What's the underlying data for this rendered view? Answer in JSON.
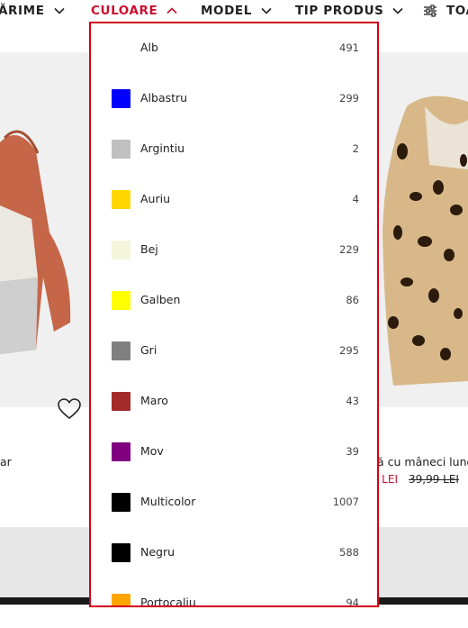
{
  "filters": [
    {
      "label": "ĂRIME",
      "active": false
    },
    {
      "label": "CULOARE",
      "active": true
    },
    {
      "label": "MODEL",
      "active": false
    },
    {
      "label": "TIP PRODUS",
      "active": false
    },
    {
      "label": "TOA",
      "active": false
    }
  ],
  "colors": {
    "accent": "#c8102e",
    "dropdown_border": "#d0021b"
  },
  "products": {
    "left": {
      "title_fragment": "ar"
    },
    "right": {
      "title_fragment": "ă cu mâneci lungi",
      "sale_price_fragment": "? LEI",
      "old_price": "39,99 LEI"
    }
  },
  "color_options": [
    {
      "label": "Alb",
      "count": "491",
      "swatch": "#ffffff"
    },
    {
      "label": "Albastru",
      "count": "299",
      "swatch": "#0000ff"
    },
    {
      "label": "Argintiu",
      "count": "2",
      "swatch": "#c0c0c0"
    },
    {
      "label": "Auriu",
      "count": "4",
      "swatch": "#ffd700"
    },
    {
      "label": "Bej",
      "count": "229",
      "swatch": "#f5f5dc"
    },
    {
      "label": "Galben",
      "count": "86",
      "swatch": "#ffff00"
    },
    {
      "label": "Gri",
      "count": "295",
      "swatch": "#808080"
    },
    {
      "label": "Maro",
      "count": "43",
      "swatch": "#a52a2a"
    },
    {
      "label": "Mov",
      "count": "39",
      "swatch": "#800080"
    },
    {
      "label": "Multicolor",
      "count": "1007",
      "swatch": "#000000"
    },
    {
      "label": "Negru",
      "count": "588",
      "swatch": "#000000"
    },
    {
      "label": "Portocaliu",
      "count": "94",
      "swatch": "#ffa500"
    }
  ]
}
